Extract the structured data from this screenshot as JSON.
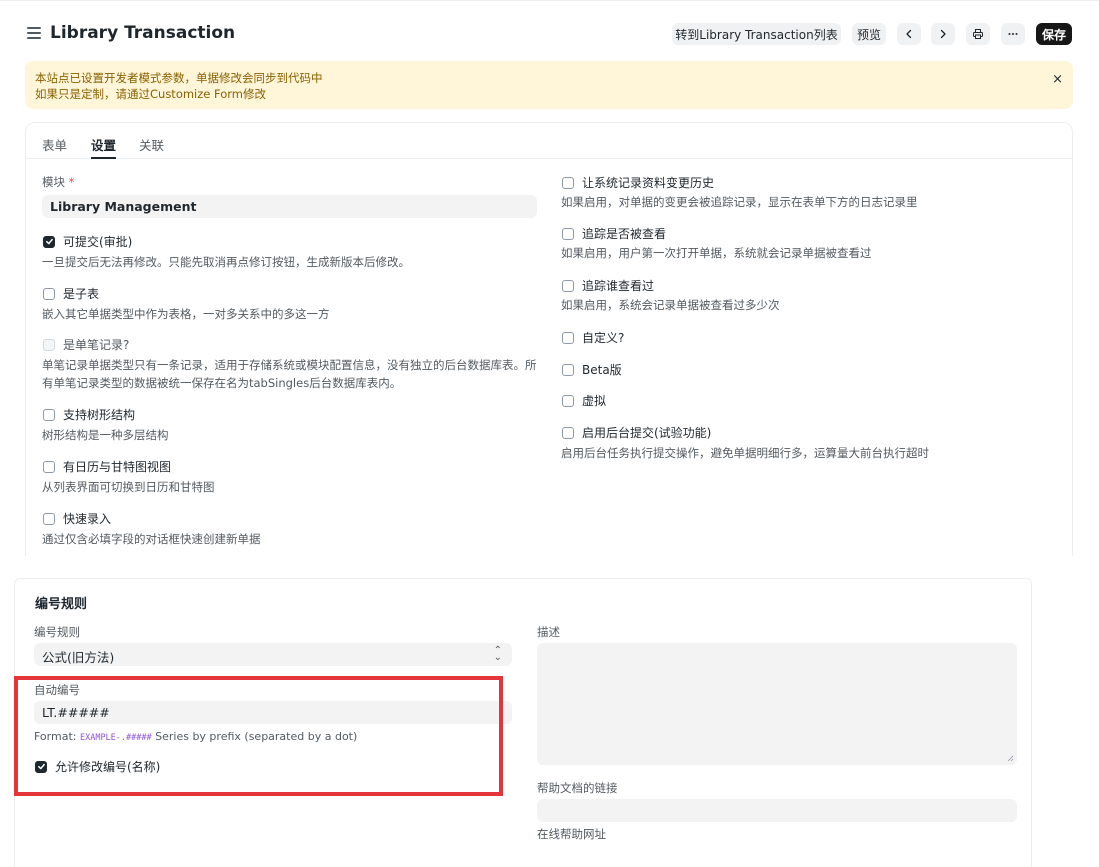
{
  "header": {
    "title": "Library Transaction",
    "goto_list_label": "转到Library Transaction列表",
    "preview_label": "预览",
    "save_label": "保存"
  },
  "alert": {
    "line1": "本站点已设置开发者模式参数，单据修改会同步到代码中",
    "line2": "如果只是定制，请通过Customize Form修改",
    "close": "×"
  },
  "tabs": [
    "表单",
    "设置",
    "关联"
  ],
  "settings": {
    "module_label": "模块",
    "module_required": "*",
    "module_value": "Library Management",
    "left": [
      {
        "label": "可提交(审批)",
        "checked": true,
        "disabled": false,
        "desc": "一旦提交后无法再修改。只能先取消再点修订按钮，生成新版本后修改。"
      },
      {
        "label": "是子表",
        "checked": false,
        "disabled": false,
        "desc": "嵌入其它单据类型中作为表格，一对多关系中的多这一方"
      },
      {
        "label": "是单笔记录?",
        "checked": false,
        "disabled": true,
        "desc": "单笔记录单据类型只有一条记录，适用于存储系统或模块配置信息，没有独立的后台数据库表。所有单笔记录类型的数据被统一保存在名为tabSingles后台数据库表内。"
      },
      {
        "label": "支持树形结构",
        "checked": false,
        "disabled": false,
        "desc": "树形结构是一种多层结构"
      },
      {
        "label": "有日历与甘特图视图",
        "checked": false,
        "disabled": false,
        "desc": "从列表界面可切换到日历和甘特图"
      },
      {
        "label": "快速录入",
        "checked": false,
        "disabled": false,
        "desc": "通过仅含必填字段的对话框快速创建新单据"
      }
    ],
    "right": [
      {
        "label": "让系统记录资料变更历史",
        "checked": false,
        "desc": "如果启用，对单据的变更会被追踪记录，显示在表单下方的日志记录里"
      },
      {
        "label": "追踪是否被查看",
        "checked": false,
        "desc": "如果启用，用户第一次打开单据，系统就会记录单据被查看过"
      },
      {
        "label": "追踪谁查看过",
        "checked": false,
        "desc": "如果启用，系统会记录单据被查看过多少次"
      },
      {
        "label": "自定义?",
        "checked": false,
        "desc": ""
      },
      {
        "label": "Beta版",
        "checked": false,
        "desc": ""
      },
      {
        "label": "虚拟",
        "checked": false,
        "desc": ""
      },
      {
        "label": "启用后台提交(试验功能)",
        "checked": false,
        "desc": "启用后台任务执行提交操作，避免单据明细行多，运算量大前台执行超时"
      }
    ]
  },
  "naming": {
    "section_title": "编号规则",
    "rule_label": "编号规则",
    "rule_value": "公式(旧方法)",
    "autoname_label": "自动编号",
    "autoname_value": "LT.#####",
    "format_prefix": "Format: ",
    "format_code": "EXAMPLE-.#####",
    "format_suffix": " Series by prefix (separated by a dot)",
    "allow_rename_label": "允许修改编号(名称)",
    "allow_rename_checked": true,
    "description_label": "描述",
    "help_link_label": "帮助文档的链接",
    "help_link_desc": "在线帮助网址"
  },
  "colors": {
    "alert_bg": "#fff6d9",
    "alert_text": "#8a6100",
    "highlight_border": "#e3353a",
    "save_bg": "#171717"
  }
}
